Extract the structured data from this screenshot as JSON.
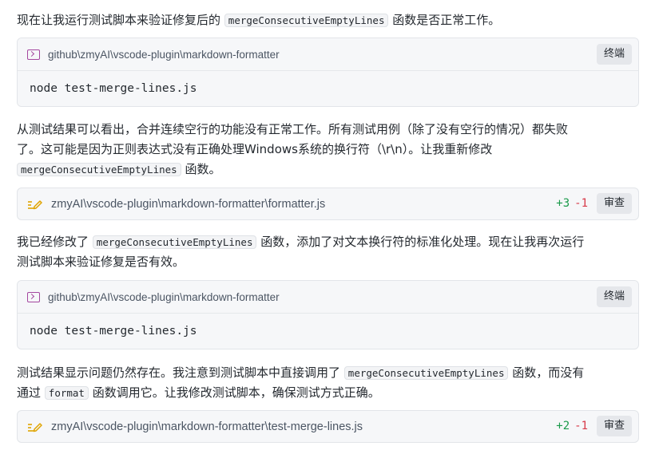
{
  "messages": {
    "p1": {
      "before": "现在让我运行测试脚本来验证修复后的",
      "code": "mergeConsecutiveEmptyLines",
      "after": "函数是否正常工作。"
    },
    "term1": {
      "path": "github\\zmyAI\\vscode-plugin\\markdown-formatter",
      "button": "终端",
      "command": "node test-merge-lines.js"
    },
    "p2": {
      "line1": "从测试结果可以看出，合并连续空行的功能没有正常工作。所有测试用例（除了没有空行的情况）都失败",
      "line2": "了。这可能是因为正则表达式没有正确处理Windows系统的换行符（\\r\\n）。让我重新修改",
      "code": "mergeConsecutiveEmptyLines",
      "after": "函数。"
    },
    "edit1": {
      "path": "zmyAI\\vscode-plugin\\markdown-formatter\\formatter.js",
      "added": "+3",
      "removed": "-1",
      "button": "审查"
    },
    "p3": {
      "before": "我已经修改了",
      "code": "mergeConsecutiveEmptyLines",
      "after": "函数，添加了对文本换行符的标准化处理。现在让我再次运行",
      "line2": "测试脚本来验证修复是否有效。"
    },
    "term2": {
      "path": "github\\zmyAI\\vscode-plugin\\markdown-formatter",
      "button": "终端",
      "command": "node test-merge-lines.js"
    },
    "p4": {
      "before": "测试结果显示问题仍然存在。我注意到测试脚本中直接调用了",
      "code": "mergeConsecutiveEmptyLines",
      "after": "函数，而没有",
      "line2_before": "通过",
      "code2": "format",
      "line2_after": "函数调用它。让我修改测试脚本，确保测试方式正确。"
    },
    "edit2": {
      "path": "zmyAI\\vscode-plugin\\markdown-formatter\\test-merge-lines.js",
      "added": "+2",
      "removed": "-1",
      "button": "审查"
    }
  },
  "colors": {
    "added": "#1a9a4a",
    "removed": "#d73a49",
    "terminal_icon": "#a4479f",
    "edit_icon": "#e0a400"
  }
}
